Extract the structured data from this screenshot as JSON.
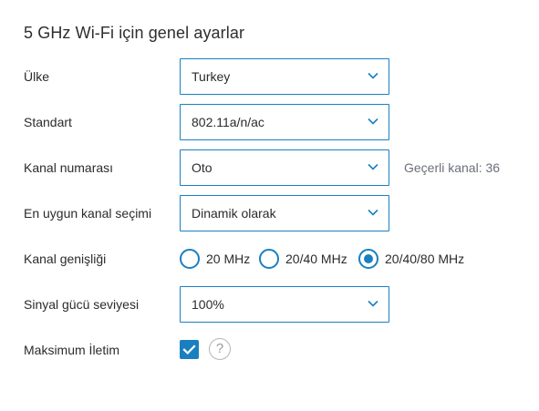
{
  "title": "5 GHz Wi-Fi için genel ayarlar",
  "country": {
    "label": "Ülke",
    "value": "Turkey"
  },
  "standard": {
    "label": "Standart",
    "value": "802.11a/n/ac"
  },
  "channel": {
    "label": "Kanal numarası",
    "value": "Oto",
    "hint": "Geçerli kanal: 36"
  },
  "best_channel": {
    "label": "En uygun kanal seçimi",
    "value": "Dinamik olarak"
  },
  "bandwidth": {
    "label": "Kanal genişliği",
    "options": [
      "20 MHz",
      "20/40 MHz",
      "20/40/80 MHz"
    ],
    "selected": "20/40/80 MHz"
  },
  "signal": {
    "label": "Sinyal gücü seviyesi",
    "value": "100%"
  },
  "max_tx": {
    "label": "Maksimum İletim",
    "checked": true
  },
  "icons": {
    "dropdown": "chevron-down-icon",
    "checkbox": "check-icon",
    "help": "question-icon"
  },
  "colors": {
    "accent": "#1a7fc1",
    "hint": "#6b6f7a"
  }
}
